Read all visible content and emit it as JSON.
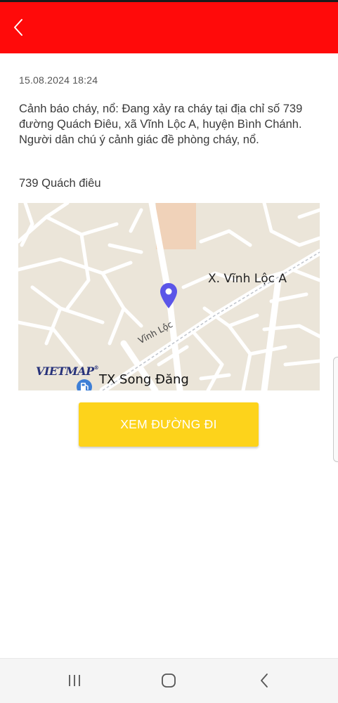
{
  "header": {
    "back_icon": "chevron-left-icon",
    "background": "#ff0a0a"
  },
  "notification": {
    "timestamp": "15.08.2024 18:24",
    "message": "Cảnh báo cháy, nổ: Đang xảy ra cháy tại địa chỉ số 739 đường Quách Điêu, xã Vĩnh Lộc A, huyện Bình Chánh. Người dân chú ý cảnh giác đề phòng cháy, nổ.",
    "address": "739 Quách điêu"
  },
  "map": {
    "labels": {
      "commune": "X. Vĩnh Lộc A",
      "road": "Vĩnh Lộc",
      "poi": "TX Song Đăng"
    },
    "logo_text": "VIETMAP",
    "logo_mark": "®",
    "pin_color": "#5b55e8",
    "pin_icon": "location-pin-icon",
    "poi_icon": "gas-station-icon"
  },
  "cta": {
    "label": "XEM ĐƯỜNG ĐI",
    "color": "#fdd31b"
  },
  "navbar": {
    "recent_icon": "recent-apps-icon",
    "home_icon": "home-icon",
    "back_icon": "back-icon"
  }
}
